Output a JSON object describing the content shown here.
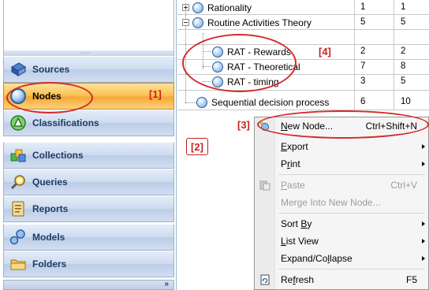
{
  "navigation": {
    "items": [
      {
        "label": "Sources"
      },
      {
        "label": "Nodes"
      },
      {
        "label": "Classifications"
      },
      {
        "label": "Collections"
      },
      {
        "label": "Queries"
      },
      {
        "label": "Reports"
      },
      {
        "label": "Models"
      },
      {
        "label": "Folders"
      }
    ],
    "footer_chevron": "»"
  },
  "nodes_tree": {
    "rows": [
      {
        "name": "Rationality",
        "col1": "1",
        "col2": "1",
        "expander": "plus"
      },
      {
        "name": "Routine Activities Theory",
        "col1": "5",
        "col2": "5",
        "expander": "minus"
      },
      {
        "name": "RAT - Rewards",
        "col1": "2",
        "col2": "2"
      },
      {
        "name": "RAT - Theoretical",
        "col1": "7",
        "col2": "8"
      },
      {
        "name": "RAT - timing",
        "col1": "3",
        "col2": "5"
      },
      {
        "name": "Sequential decision process",
        "col1": "6",
        "col2": "10"
      }
    ]
  },
  "annotations": {
    "nodes_marker": "[1]",
    "blank_area_marker": "[2]",
    "new_node_marker": "[3]",
    "child_nodes_marker": "[4]"
  },
  "context_menu": {
    "new_node": {
      "pre": "",
      "key": "N",
      "post": "ew Node...",
      "shortcut": "Ctrl+Shift+N"
    },
    "export": {
      "pre": "",
      "key": "E",
      "post": "xport"
    },
    "print": {
      "pre": "P",
      "key": "r",
      "post": "int"
    },
    "paste": {
      "pre": "",
      "key": "P",
      "post": "aste",
      "shortcut": "Ctrl+V"
    },
    "merge": {
      "label": "Merge Into New Node..."
    },
    "sort_by": {
      "pre": "Sort ",
      "key": "B",
      "post": "y"
    },
    "list_view": {
      "pre": "",
      "key": "L",
      "post": "ist View"
    },
    "expand_collapse": {
      "pre": "Expand/Co",
      "key": "l",
      "post": "lapse"
    },
    "refresh": {
      "pre": "Re",
      "key": "f",
      "post": "resh",
      "shortcut": "F5"
    }
  },
  "colors": {
    "annotation_red": "#cc1f1f",
    "nav_active": "#f7a838",
    "nav_inactive": "#cfdcef",
    "nav_text": "#1e3c66"
  }
}
